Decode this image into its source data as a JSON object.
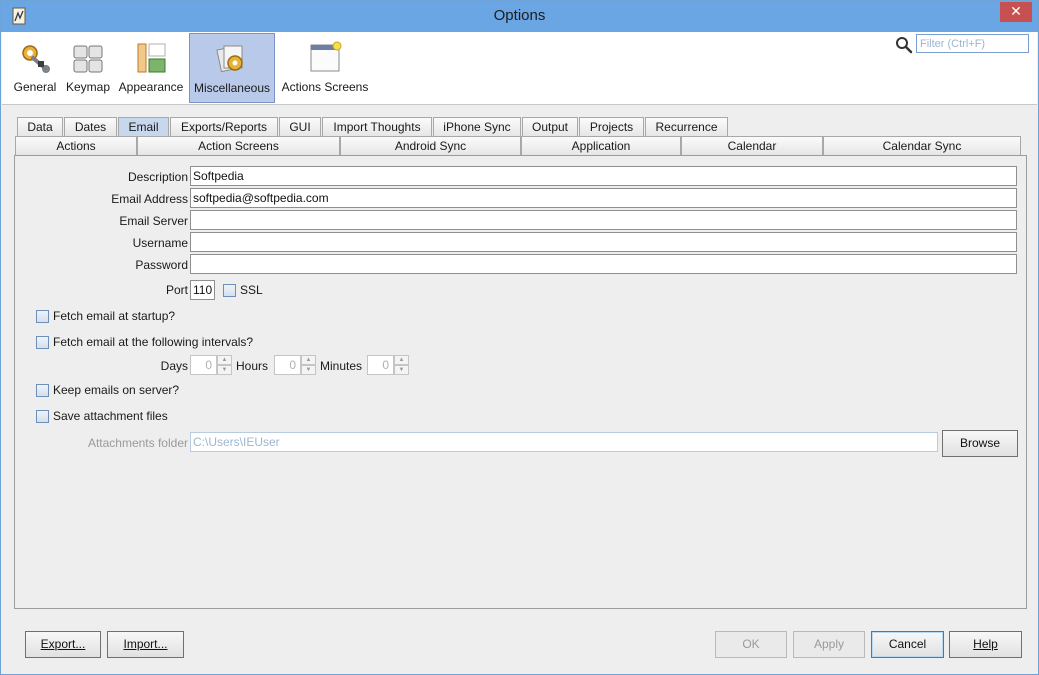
{
  "window": {
    "title": "Options",
    "close_glyph": "✕",
    "app_icon": "app-icon"
  },
  "categories": [
    {
      "label": "General",
      "icon": "gear-wrench-icon",
      "selected": false
    },
    {
      "label": "Keymap",
      "icon": "keyboard-icon",
      "selected": false
    },
    {
      "label": "Appearance",
      "icon": "appearance-icon",
      "selected": false
    },
    {
      "label": "Miscellaneous",
      "icon": "misc-icon",
      "selected": true
    },
    {
      "label": "Actions Screens",
      "icon": "window-icon",
      "selected": false
    }
  ],
  "search": {
    "placeholder": "Filter (Ctrl+F)",
    "value": ""
  },
  "tabs_row1": [
    "Data",
    "Dates",
    "Email",
    "Exports/Reports",
    "GUI",
    "Import Thoughts",
    "iPhone Sync",
    "Output",
    "Projects",
    "Recurrence"
  ],
  "tabs_row2": [
    "Actions",
    "Action Screens",
    "Android Sync",
    "Application",
    "Calendar",
    "Calendar Sync"
  ],
  "active_tab": "Email",
  "email": {
    "description": {
      "label": "Description",
      "value": "Softpedia"
    },
    "address": {
      "label": "Email Address",
      "value": "softpedia@softpedia.com"
    },
    "server": {
      "label": "Email Server",
      "value": ""
    },
    "username": {
      "label": "Username",
      "value": ""
    },
    "password": {
      "label": "Password",
      "value": ""
    },
    "port": {
      "label": "Port",
      "value": "110"
    },
    "ssl": {
      "label": "SSL",
      "checked": false
    },
    "fetch_startup": {
      "label": "Fetch email at startup?",
      "checked": false
    },
    "fetch_intervals": {
      "label": "Fetch email at the following intervals?",
      "checked": false
    },
    "days": {
      "label": "Days",
      "value": "0"
    },
    "hours": {
      "label": "Hours",
      "value": "0"
    },
    "minutes": {
      "label": "Minutes",
      "value": "0"
    },
    "keep_on_server": {
      "label": "Keep emails on server?",
      "checked": false
    },
    "save_attachments": {
      "label": "Save attachment files",
      "checked": false
    },
    "attachments_folder": {
      "label": "Attachments folder",
      "value": "C:\\Users\\IEUser"
    },
    "browse": "Browse"
  },
  "footer": {
    "export": "Export...",
    "import": "Import...",
    "ok": "OK",
    "apply": "Apply",
    "cancel": "Cancel",
    "help": "Help"
  },
  "colors": {
    "titlebar": "#6aa6e3",
    "selected_category": "#b9c9ea",
    "close": "#c75050"
  }
}
